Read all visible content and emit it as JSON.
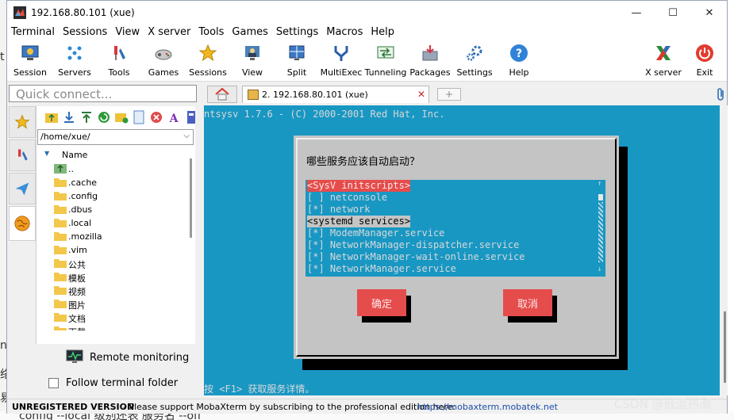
{
  "window": {
    "title": "192.168.80.101 (xue)"
  },
  "titlebar_buttons": {
    "minimize": "—",
    "maximize": "☐",
    "close": "✕"
  },
  "menu": [
    "Terminal",
    "Sessions",
    "View",
    "X server",
    "Tools",
    "Games",
    "Settings",
    "Macros",
    "Help"
  ],
  "toolbar": {
    "session": "Session",
    "servers": "Servers",
    "tools": "Tools",
    "games": "Games",
    "sessions": "Sessions",
    "view": "View",
    "split": "Split",
    "multiexec": "MultiExec",
    "tunneling": "Tunneling",
    "packages": "Packages",
    "settings": "Settings",
    "help": "Help",
    "xserver": "X server",
    "exit": "Exit"
  },
  "quick_connect": {
    "placeholder": "Quick connect..."
  },
  "sftp": {
    "path": "/home/xue/",
    "column_name": "Name",
    "files": [
      "..",
      ".cache",
      ".config",
      ".dbus",
      ".local",
      ".mozilla",
      ".vim",
      "公共",
      "模板",
      "视频",
      "图片",
      "文档",
      "下载"
    ]
  },
  "remote_monitoring": "Remote monitoring",
  "follow_folder": "Follow terminal folder",
  "tabs": {
    "session_tab": "2. 192.168.80.101 (xue)"
  },
  "terminal": {
    "header": "ntsysv 1.7.6 - (C) 2000-2001 Red Hat, Inc.",
    "dialog_title": "哪些服务应该自动启动？",
    "items": [
      "<SysV initscripts>",
      "[ ] netconsole",
      "[*] network",
      "<systemd services>",
      "[*] ModemManager.service",
      "[*] NetworkManager-dispatcher.service",
      "[*] NetworkManager-wait-online.service",
      "[*] NetworkManager.service"
    ],
    "ok_button": "确定",
    "cancel_button": "取消",
    "footer": "按 <F1> 获取服务详情。"
  },
  "status": {
    "unregistered": "UNREGISTERED VERSION",
    "message": "-  Please support MobaXterm by subscribing to the professional edition here:",
    "link": "https://mobaxterm.mobatek.net"
  },
  "background": {
    "glyphs": [
      "t",
      "n",
      "络",
      "易"
    ],
    "bottom_text": "config --local 级别还表 服务名 --off"
  },
  "watermark": "CSDN @低温热潮",
  "colors": {
    "terminal_bg": "#1897c3",
    "selection": "#e54c4c",
    "dialog_bg": "#c4c4c4"
  }
}
